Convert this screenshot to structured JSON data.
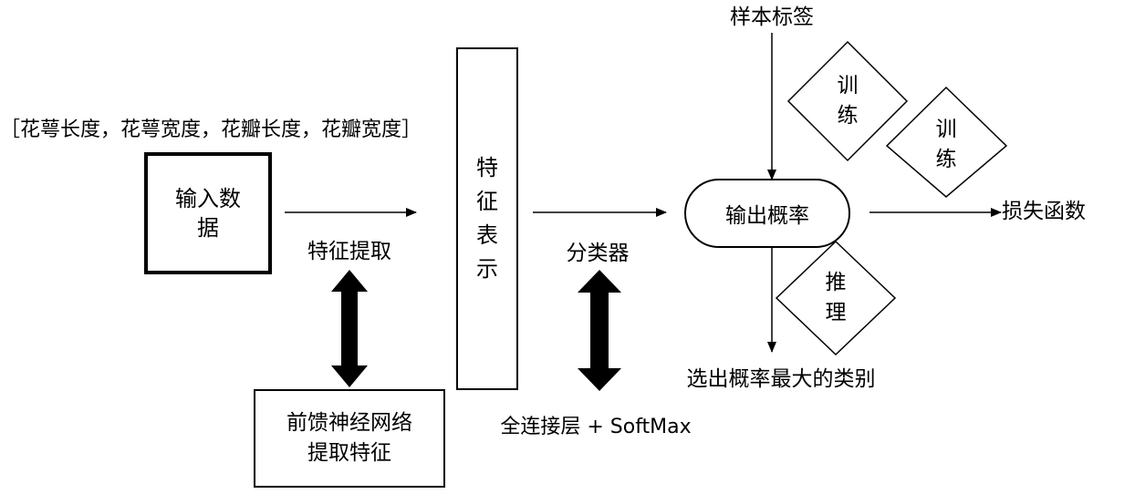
{
  "features_label": "［花萼长度，花萼宽度，花瓣长度，花瓣宽度］",
  "input_box": "输入数\n据",
  "feature_extraction_label": "特征提取",
  "ffn_box": "前馈神经网络\n提取特征",
  "feature_repr_box": "特\n征\n表\n示",
  "classifier_label": "分类器",
  "fc_softmax_label": "全连接层 + SoftMax",
  "sample_label": "样本标签",
  "train_diamond_1": "训\n练",
  "train_diamond_2": "训\n练",
  "output_prob_box": "输出概率",
  "loss_label": "损失函数",
  "infer_diamond": "推\n理",
  "select_label": "选出概率最大的类别"
}
